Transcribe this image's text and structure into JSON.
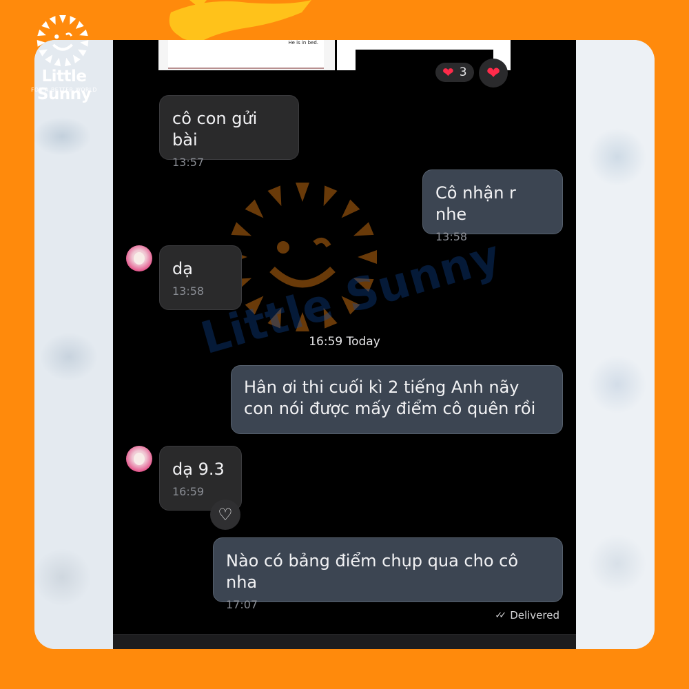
{
  "brand": {
    "name": "Little Sunny",
    "tagline": "FOR A BETTER WORLD",
    "orange": "#ff8a0c",
    "yellow": "#ffc21a",
    "watermark_blue": "#0f4aa2"
  },
  "top_attachment": {
    "caption": "He is in bed."
  },
  "reactions": {
    "emoji": "❤",
    "count": "3",
    "button_emoji": "❤"
  },
  "messages": [
    {
      "side": "in",
      "text": "cô con gửi bài",
      "time": "13:57"
    },
    {
      "side": "out",
      "text": "Cô nhận r nhe",
      "time": "13:58"
    },
    {
      "side": "in",
      "text": "dạ",
      "time": "13:58"
    },
    {
      "side": "out",
      "text": "Hân ơi thi cuối kì 2 tiếng Anh nãy con nói được mấy điểm cô quên rồi",
      "time": ""
    },
    {
      "side": "in",
      "text": "dạ 9.3",
      "time": "16:59"
    },
    {
      "side": "out",
      "text": "Nào có bảng điểm chụp qua cho cô nha",
      "time": "17:07"
    }
  ],
  "date_separator": "16:59 Today",
  "status": {
    "delivered_label": "Delivered",
    "check_icon": "✓✓"
  },
  "like_icon": "♡",
  "watermark": {
    "text": "Little Sunny"
  }
}
